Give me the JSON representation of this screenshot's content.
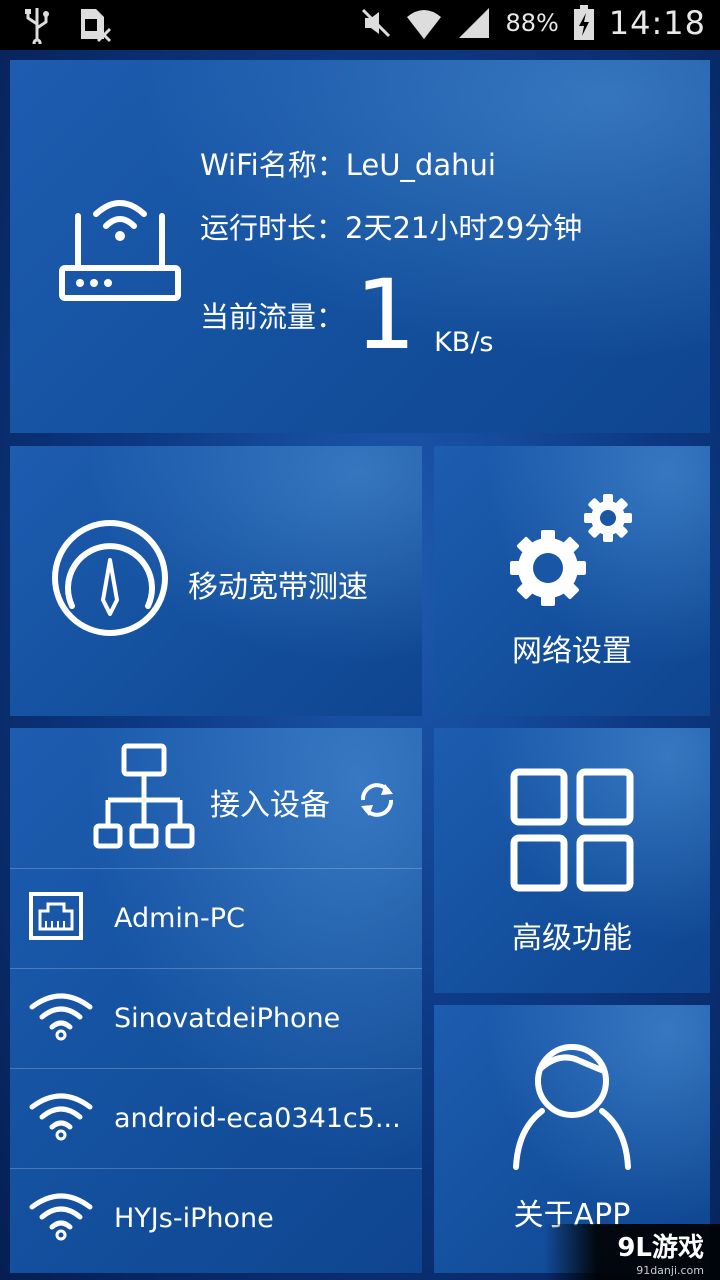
{
  "status_bar": {
    "battery_percent": "88%",
    "time": "14:18",
    "icons": [
      "usb-icon",
      "sim-missing-icon",
      "mute-icon",
      "wifi-signal-icon",
      "cell-signal-icon",
      "battery-charging-icon"
    ]
  },
  "wifi_card": {
    "ssid_line": "WiFi名称：LeU_dahui",
    "uptime_line": "运行时长：2天21小时29分钟",
    "traffic_label": "当前流量：",
    "traffic_value": "1",
    "traffic_unit": "KB/s",
    "icon": "router-icon"
  },
  "tiles": {
    "speed_test": {
      "label": "移动宽带测速",
      "icon": "speedometer-icon"
    },
    "network_settings": {
      "label": "网络设置",
      "icon": "gears-icon"
    },
    "advanced": {
      "label": "高级功能",
      "icon": "grid-icon"
    },
    "about": {
      "label": "关于APP",
      "icon": "user-icon"
    }
  },
  "devices": {
    "title": "接入设备",
    "icon": "network-topology-icon",
    "refresh_icon": "refresh-icon",
    "items": [
      {
        "name": "Admin-PC",
        "icon": "ethernet-port-icon"
      },
      {
        "name": "SinovatdeiPhone",
        "icon": "wifi-icon"
      },
      {
        "name": "android-eca0341c5...",
        "icon": "wifi-icon"
      },
      {
        "name": "HYJs-iPhone",
        "icon": "wifi-icon"
      }
    ]
  },
  "watermark": {
    "main": "9L游戏",
    "sub": "91danji.com"
  }
}
